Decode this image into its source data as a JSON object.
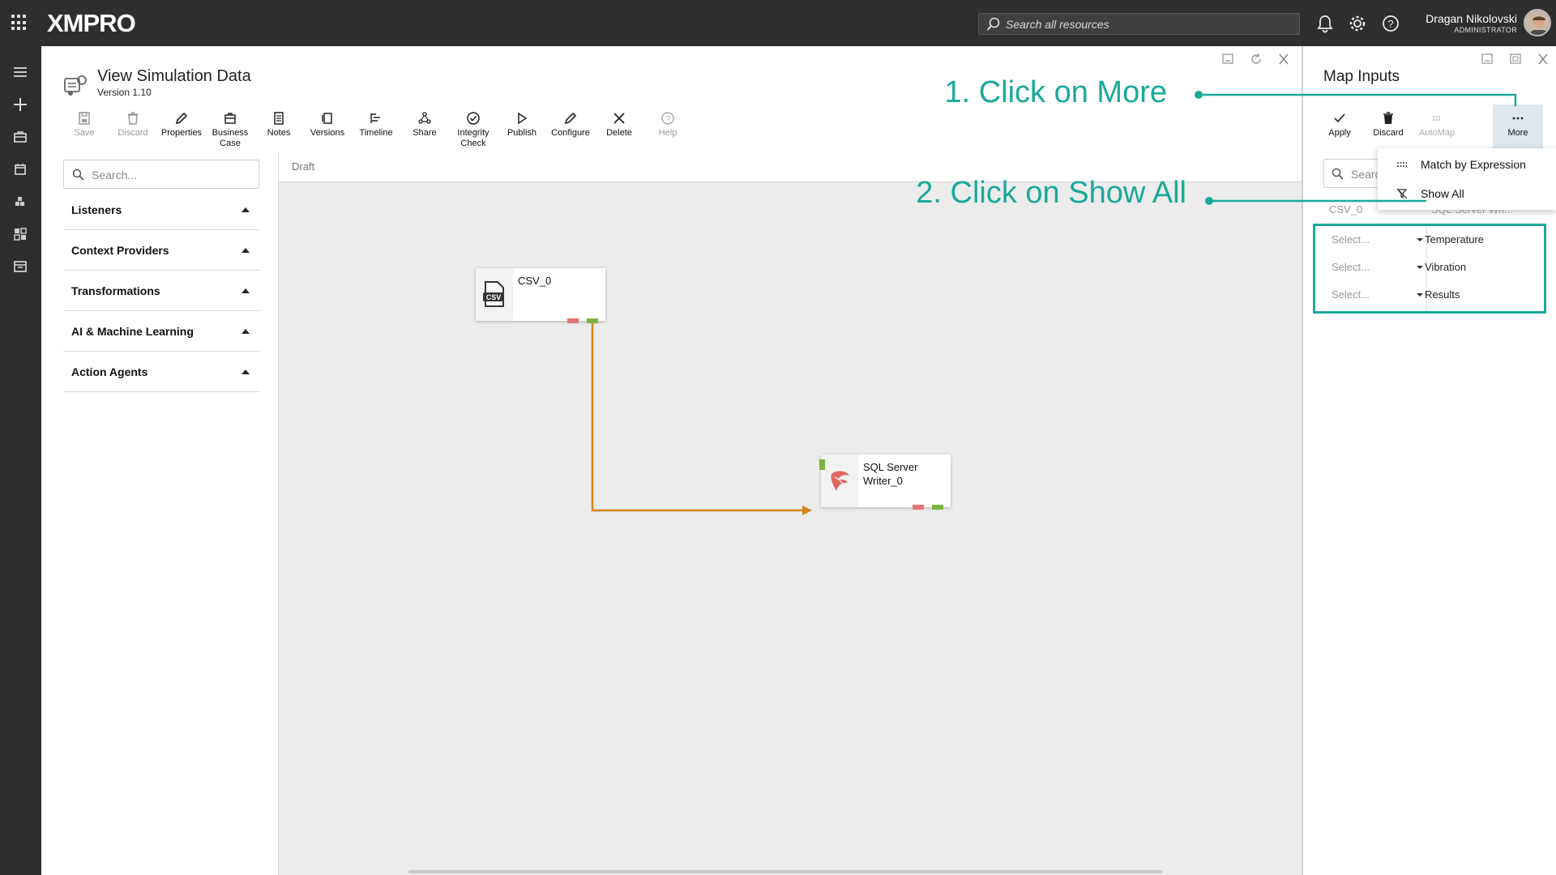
{
  "topbar": {
    "logo": "XMPRO",
    "search_placeholder": "Search all resources",
    "user_name": "Dragan Nikolovski",
    "user_role": "ADMINISTRATOR"
  },
  "document": {
    "title": "View Simulation Data",
    "version": "Version 1.10"
  },
  "toolbar": [
    {
      "label": "Save",
      "icon": "save-icon",
      "enabled": false
    },
    {
      "label": "Discard",
      "icon": "trash-icon",
      "enabled": false
    },
    {
      "label": "Properties",
      "icon": "pencil-icon",
      "enabled": true
    },
    {
      "label": "Business Case",
      "icon": "briefcase-icon",
      "enabled": true
    },
    {
      "label": "Notes",
      "icon": "notes-icon",
      "enabled": true
    },
    {
      "label": "Versions",
      "icon": "versions-icon",
      "enabled": true
    },
    {
      "label": "Timeline",
      "icon": "timeline-icon",
      "enabled": true
    },
    {
      "label": "Share",
      "icon": "share-icon",
      "enabled": true
    },
    {
      "label": "Integrity Check",
      "icon": "check-circle-icon",
      "enabled": true
    },
    {
      "label": "Publish",
      "icon": "play-icon",
      "enabled": true
    },
    {
      "label": "Configure",
      "icon": "pencil-icon",
      "enabled": true
    },
    {
      "label": "Delete",
      "icon": "close-icon",
      "enabled": true
    },
    {
      "label": "Help",
      "icon": "help-icon",
      "enabled": false
    }
  ],
  "palette": {
    "search_placeholder": "Search...",
    "categories": [
      "Listeners",
      "Context Providers",
      "Transformations",
      "AI & Machine Learning",
      "Action Agents"
    ]
  },
  "canvas": {
    "status": "Draft",
    "nodes": [
      {
        "label": "CSV_0",
        "icon": "csv-file-icon"
      },
      {
        "label": "SQL Server Writer_0",
        "icon": "sql-server-icon"
      }
    ]
  },
  "map_inputs": {
    "title": "Map Inputs",
    "toolbar": [
      {
        "label": "Apply",
        "icon": "check-icon",
        "enabled": true
      },
      {
        "label": "Discard",
        "icon": "trash-icon",
        "enabled": true
      },
      {
        "label": "AutoMap",
        "icon": "automap-icon",
        "enabled": false
      },
      {
        "label": "More",
        "icon": "more-icon",
        "enabled": true
      }
    ],
    "search_placeholder": "Search",
    "source_column": "CSV_0",
    "target_column": "SQL Server Wri...",
    "rows": [
      {
        "select": "Select...",
        "field": "Temperature"
      },
      {
        "select": "Select...",
        "field": "Vibration"
      },
      {
        "select": "Select...",
        "field": "Results"
      }
    ],
    "more_menu": [
      {
        "label": "Match by Expression",
        "icon": "expression-icon"
      },
      {
        "label": "Show All",
        "icon": "show-all-icon"
      }
    ]
  },
  "annotations": {
    "step1": "1. Click on More",
    "step2": "2. Click on Show All",
    "color": "#1aa99a"
  },
  "colors": {
    "topbar": "#2e2e2e",
    "accent": "#1aa99a",
    "connector": "#d4841a",
    "port_out": "#7cb342",
    "port_err": "#e57373"
  }
}
